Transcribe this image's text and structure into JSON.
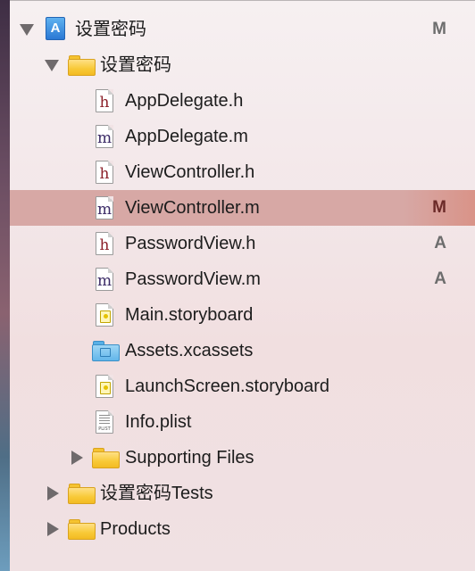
{
  "project": {
    "name": "设置密码",
    "status": "M",
    "icon": "xcode-project-icon"
  },
  "group": {
    "name": "设置密码",
    "icon": "folder-icon"
  },
  "files": [
    {
      "name": "AppDelegate.h",
      "icon": "header-file-icon",
      "type_glyph": "h",
      "status": ""
    },
    {
      "name": "AppDelegate.m",
      "icon": "source-file-icon",
      "type_glyph": "m",
      "status": ""
    },
    {
      "name": "ViewController.h",
      "icon": "header-file-icon",
      "type_glyph": "h",
      "status": ""
    },
    {
      "name": "ViewController.m",
      "icon": "source-file-icon",
      "type_glyph": "m",
      "status": "M",
      "selected": true
    },
    {
      "name": "PasswordView.h",
      "icon": "header-file-icon",
      "type_glyph": "h",
      "status": "A"
    },
    {
      "name": "PasswordView.m",
      "icon": "source-file-icon",
      "type_glyph": "m",
      "status": "A"
    },
    {
      "name": "Main.storyboard",
      "icon": "storyboard-file-icon",
      "status": ""
    },
    {
      "name": "Assets.xcassets",
      "icon": "asset-catalog-icon",
      "status": ""
    },
    {
      "name": "LaunchScreen.storyboard",
      "icon": "storyboard-file-icon",
      "status": ""
    },
    {
      "name": "Info.plist",
      "icon": "plist-file-icon",
      "plist_tag": "PLIST",
      "status": ""
    },
    {
      "name": "Supporting Files",
      "icon": "folder-icon",
      "status": ""
    }
  ],
  "tests_group": {
    "name": "设置密码Tests",
    "icon": "folder-icon"
  },
  "products_group": {
    "name": "Products",
    "icon": "folder-icon"
  },
  "colors": {
    "selection": "#d7a8a5",
    "folder": "#f8c936",
    "header_glyph": "#8b1f28",
    "source_glyph": "#3b2a66"
  }
}
